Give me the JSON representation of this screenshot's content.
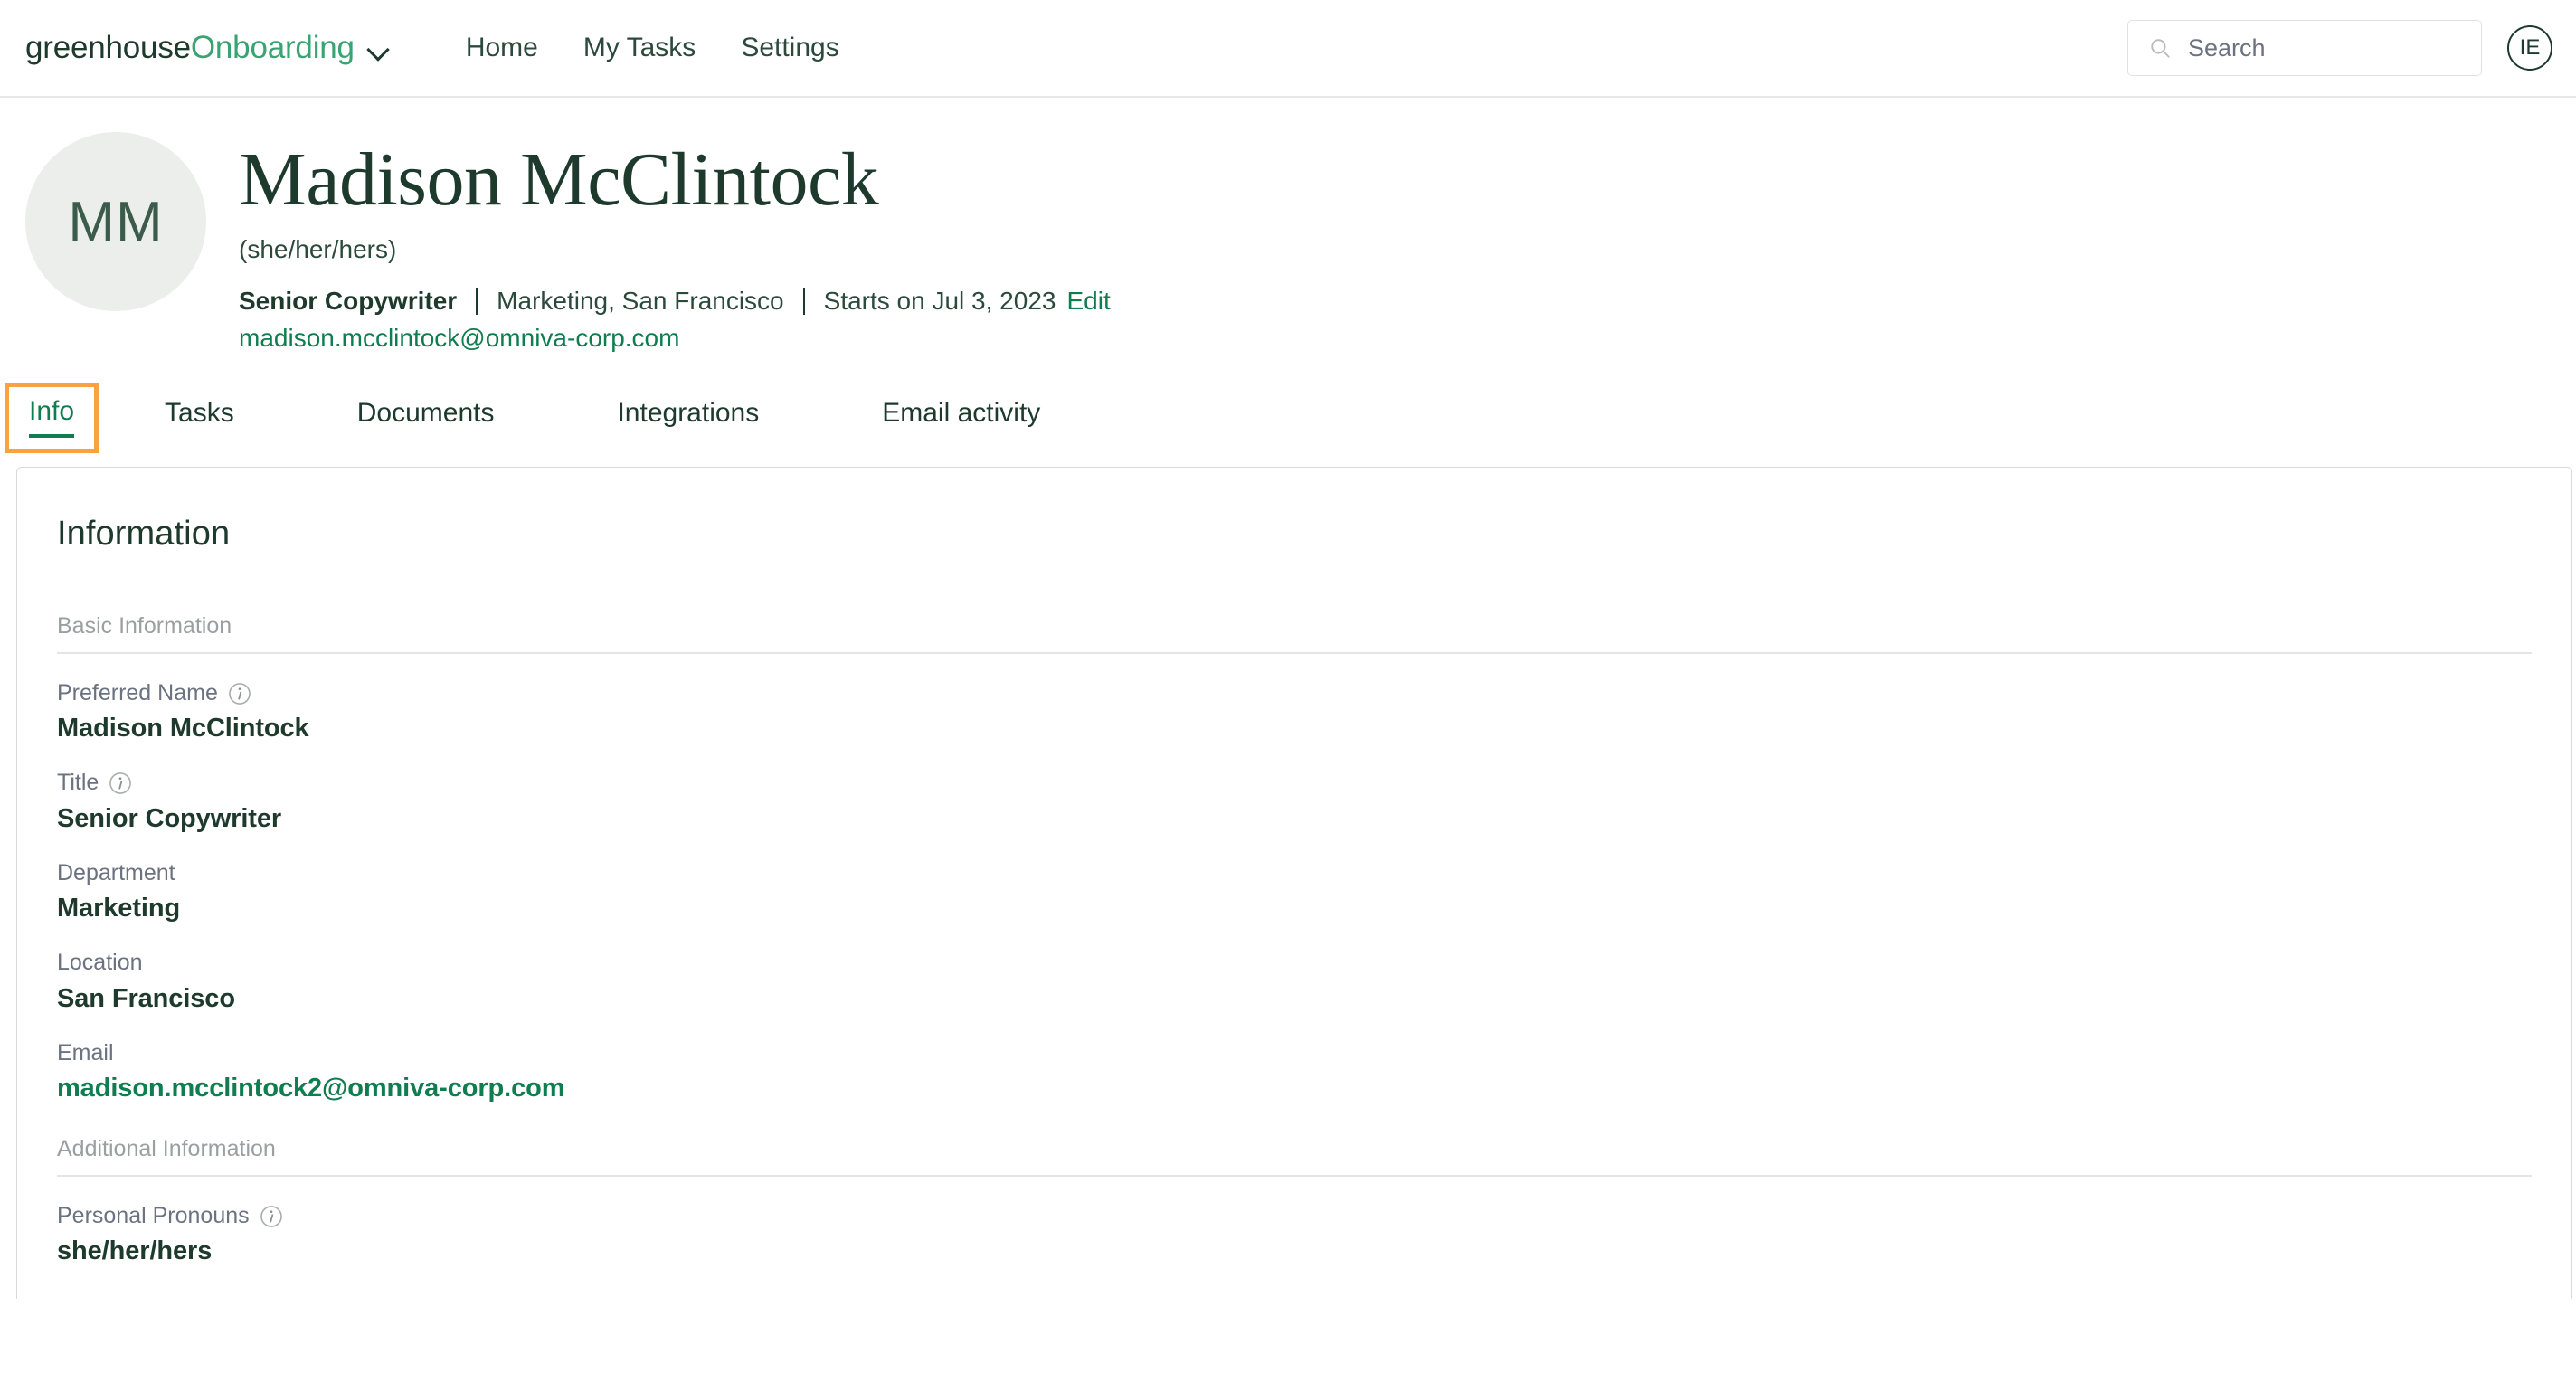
{
  "header": {
    "brand_primary": "greenhouse",
    "brand_secondary": "Onboarding",
    "nav": [
      {
        "label": "Home"
      },
      {
        "label": "My Tasks"
      },
      {
        "label": "Settings"
      }
    ],
    "search_placeholder": "Search",
    "user_initials": "IE"
  },
  "profile": {
    "initials": "MM",
    "name": "Madison McClintock",
    "pronouns": "(she/her/hers)",
    "title": "Senior Copywriter",
    "department_location": "Marketing, San Francisco",
    "start_date": "Starts on Jul 3, 2023",
    "edit_label": "Edit",
    "email": "madison.mcclintock@omniva-corp.com"
  },
  "tabs": [
    {
      "label": "Info",
      "active": true
    },
    {
      "label": "Tasks",
      "active": false
    },
    {
      "label": "Documents",
      "active": false
    },
    {
      "label": "Integrations",
      "active": false
    },
    {
      "label": "Email activity",
      "active": false
    }
  ],
  "information": {
    "title": "Information",
    "sections": [
      {
        "label": "Basic Information",
        "fields": [
          {
            "label": "Preferred Name",
            "value": "Madison McClintock",
            "info": true,
            "link": false
          },
          {
            "label": "Title",
            "value": "Senior Copywriter",
            "info": true,
            "link": false
          },
          {
            "label": "Department",
            "value": "Marketing",
            "info": false,
            "link": false
          },
          {
            "label": "Location",
            "value": "San Francisco",
            "info": false,
            "link": false
          },
          {
            "label": "Email",
            "value": "madison.mcclintock2@omniva-corp.com",
            "info": false,
            "link": true
          }
        ]
      },
      {
        "label": "Additional Information",
        "fields": [
          {
            "label": "Personal Pronouns",
            "value": "she/her/hers",
            "info": true,
            "link": false
          }
        ]
      }
    ]
  },
  "colors": {
    "brand_dark_green": "#1e3a2d",
    "brand_light_green": "#3aa372",
    "link_green": "#0f7d50",
    "focus_orange": "#f7a440",
    "muted_gray": "#6b7280",
    "avatar_bg": "#eceeec"
  }
}
